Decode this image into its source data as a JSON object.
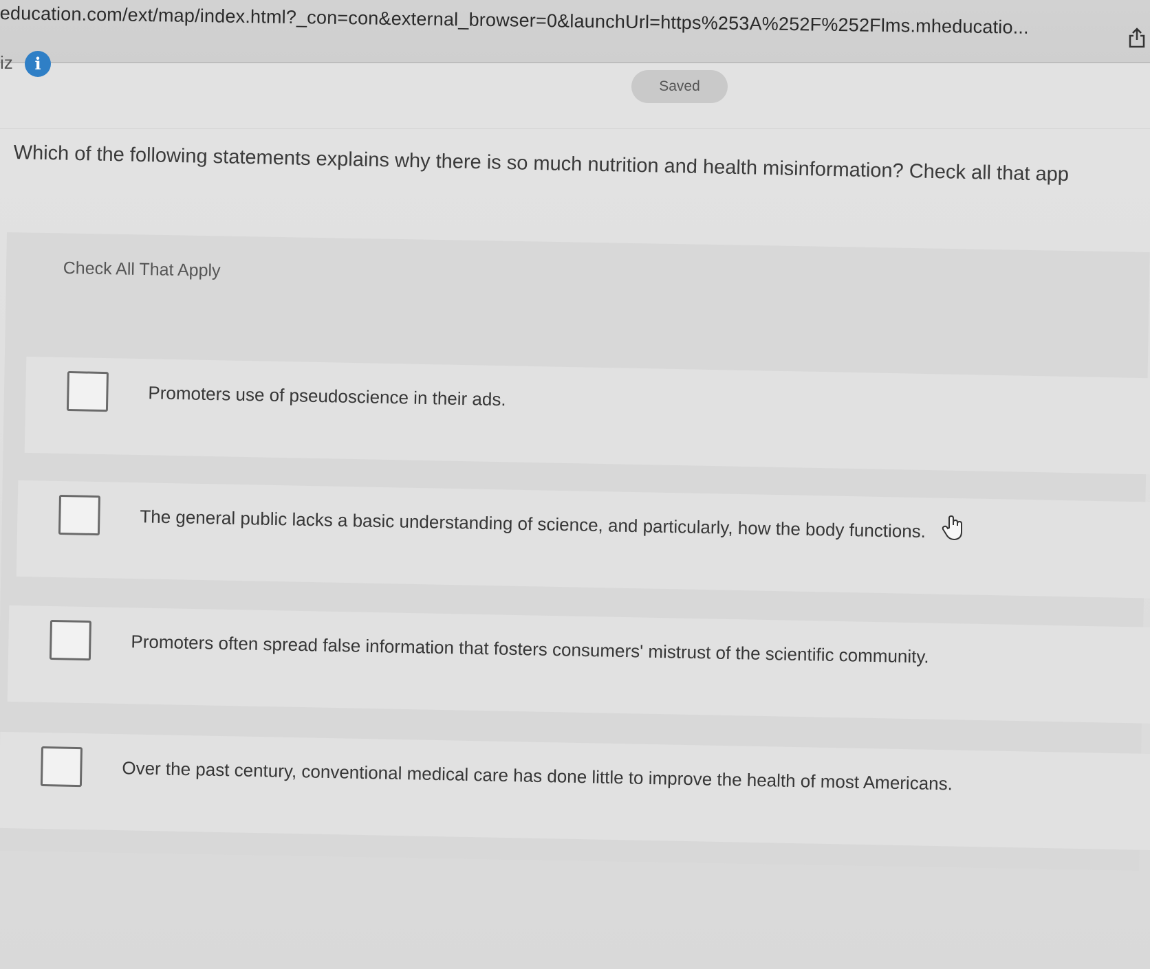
{
  "browser": {
    "url": "education.com/ext/map/index.html?_con=con&external_browser=0&launchUrl=https%253A%252F%252Flms.mheducatio..."
  },
  "header": {
    "quiz_label": "iz",
    "info_icon": "i",
    "saved_label": "Saved"
  },
  "question": {
    "text": "Which of the following statements explains why there is so much nutrition and health misinformation? Check all that app",
    "instruction": "Check All That Apply"
  },
  "choices": [
    {
      "label": "Promoters use of pseudoscience in their ads.",
      "checked": false
    },
    {
      "label": "The general public lacks a basic understanding of science, and particularly, how the body functions.",
      "checked": false
    },
    {
      "label": "Promoters often spread false information that fosters consumers' mistrust of the scientific community.",
      "checked": false
    },
    {
      "label": "Over the past century, conventional medical care has done little to improve the health of most Americans.",
      "checked": false
    }
  ],
  "icons": {
    "share": "share-icon",
    "info": "info-icon",
    "cursor": "hand-pointer-icon"
  },
  "colors": {
    "info_blue": "#2f7fc6",
    "saved_pill": "#c9c9c9",
    "background": "#e0e0e0"
  }
}
